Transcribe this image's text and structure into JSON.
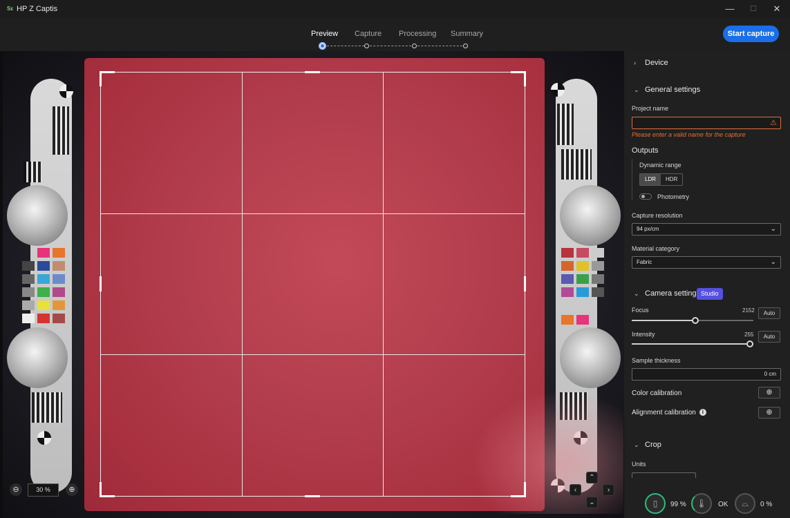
{
  "window": {
    "title": "HP Z Captis",
    "minimize": "—",
    "maximize": "☐",
    "close": "✕"
  },
  "steps": [
    {
      "label": "Preview",
      "active": true
    },
    {
      "label": "Capture",
      "active": false
    },
    {
      "label": "Processing",
      "active": false
    },
    {
      "label": "Summary",
      "active": false
    }
  ],
  "header": {
    "start_capture": "Start capture"
  },
  "preview": {
    "zoom_value": "30 %",
    "zoom_out_icon": "zoom-out-icon",
    "zoom_in_icon": "zoom-in-icon",
    "nav": {
      "up": "⌃",
      "down": "⌄",
      "left": "‹",
      "right": "›"
    }
  },
  "panel": {
    "device": {
      "label": "Device"
    },
    "general": {
      "label": "General settings",
      "project_name_label": "Project name",
      "project_name_value": "",
      "error": "Please enter a valid name for the capture",
      "outputs_label": "Outputs",
      "dynamic_range_label": "Dynamic range",
      "dr_options": [
        "LDR",
        "HDR"
      ],
      "dr_selected": "LDR",
      "photometry_label": "Photometry",
      "photometry_on": false,
      "capture_resolution_label": "Capture resolution",
      "capture_resolution_value": "94 px/cm",
      "material_category_label": "Material category",
      "material_category_value": "Fabric"
    },
    "camera": {
      "label": "Camera settings",
      "badge": "Studio",
      "focus_label": "Focus",
      "focus_value": "2152",
      "focus_fraction": 0.54,
      "intensity_label": "Intensity",
      "intensity_value": "255",
      "intensity_fraction": 1.0,
      "auto_label": "Auto",
      "sample_thickness_label": "Sample thickness",
      "sample_thickness_value": "0 cm",
      "color_calibration_label": "Color calibration",
      "alignment_calibration_label": "Alignment calibration"
    },
    "crop": {
      "label": "Crop",
      "units_label": "Units"
    }
  },
  "status": {
    "battery_value": "99 %",
    "temperature_value": "OK",
    "storage_value": "0 %"
  },
  "colors": {
    "accent": "#1a6ee8",
    "error": "#e0713a",
    "badge": "#5550e0",
    "leather": "#b23d4c",
    "ring_ok": "#2bbf7a"
  }
}
